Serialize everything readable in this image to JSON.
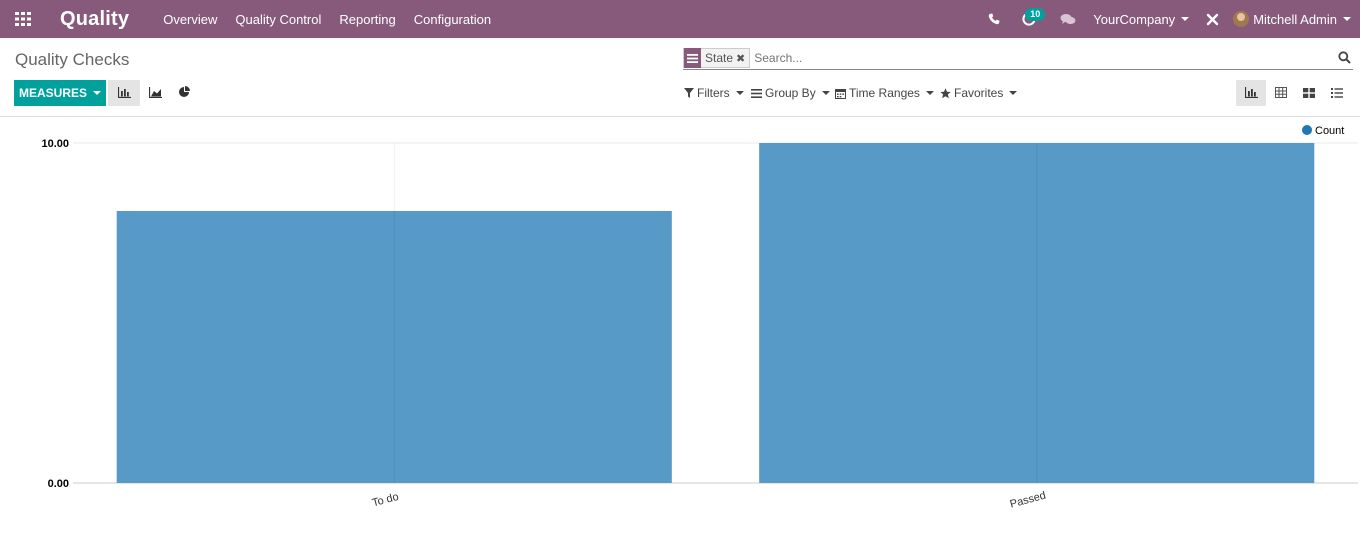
{
  "navbar": {
    "brand": "Quality",
    "menu": [
      "Overview",
      "Quality Control",
      "Reporting",
      "Configuration"
    ],
    "activity_count": "10",
    "company": "YourCompany",
    "user": "Mitchell Admin"
  },
  "control_panel": {
    "title": "Quality Checks",
    "search": {
      "facet_label": "State",
      "placeholder": "Search..."
    },
    "measures_label": "MEASURES",
    "filters": [
      "Filters",
      "Group By",
      "Time Ranges",
      "Favorites"
    ]
  },
  "colors": {
    "navbar": "#875a7b",
    "accent": "#00a09d",
    "bar": "#5799c7",
    "legend_dot": "#1f77b4"
  },
  "chart_data": {
    "type": "bar",
    "categories": [
      "To do",
      "Passed"
    ],
    "series": [
      {
        "name": "Count",
        "values": [
          8,
          10
        ]
      }
    ],
    "ylim": [
      0,
      10
    ],
    "yticks": [
      "0.00",
      "10.00"
    ],
    "legend": "top-right",
    "grid": true
  }
}
